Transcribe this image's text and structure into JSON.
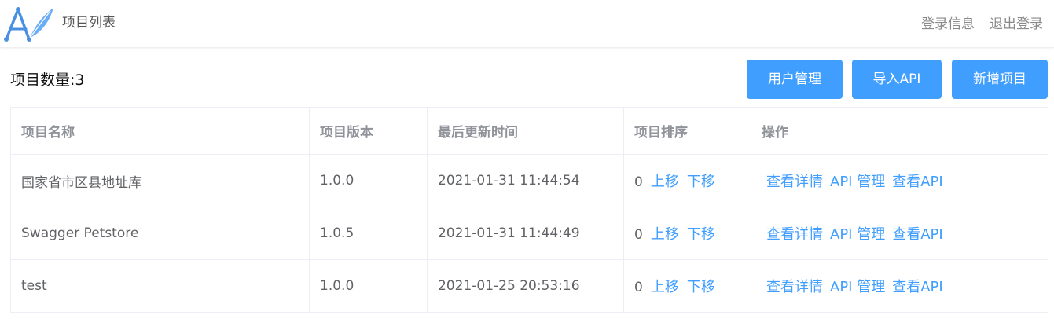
{
  "header": {
    "title": "项目列表",
    "links": [
      "登录信息",
      "退出登录"
    ]
  },
  "toolbar": {
    "count_label": "项目数量:3",
    "buttons": [
      "用户管理",
      "导入API",
      "新增项目"
    ]
  },
  "table": {
    "columns": [
      "项目名称",
      "项目版本",
      "最后更新时间",
      "项目排序",
      "操作"
    ],
    "rows": [
      {
        "name": "国家省市区县地址库",
        "version": "1.0.0",
        "updated": "2021-01-31 11:44:54",
        "order": "0"
      },
      {
        "name": "Swagger Petstore",
        "version": "1.0.5",
        "updated": "2021-01-31 11:44:49",
        "order": "0"
      },
      {
        "name": "test",
        "version": "1.0.0",
        "updated": "2021-01-25 20:53:16",
        "order": "0"
      }
    ],
    "sort_actions": [
      "上移",
      "下移"
    ],
    "row_actions": [
      "查看详情",
      "API 管理",
      "查看API"
    ]
  },
  "colors": {
    "accent": "#409eff",
    "header_text": "#909399",
    "body_text": "#606266"
  },
  "icons": {
    "logo": "feather-a-logo-icon"
  }
}
